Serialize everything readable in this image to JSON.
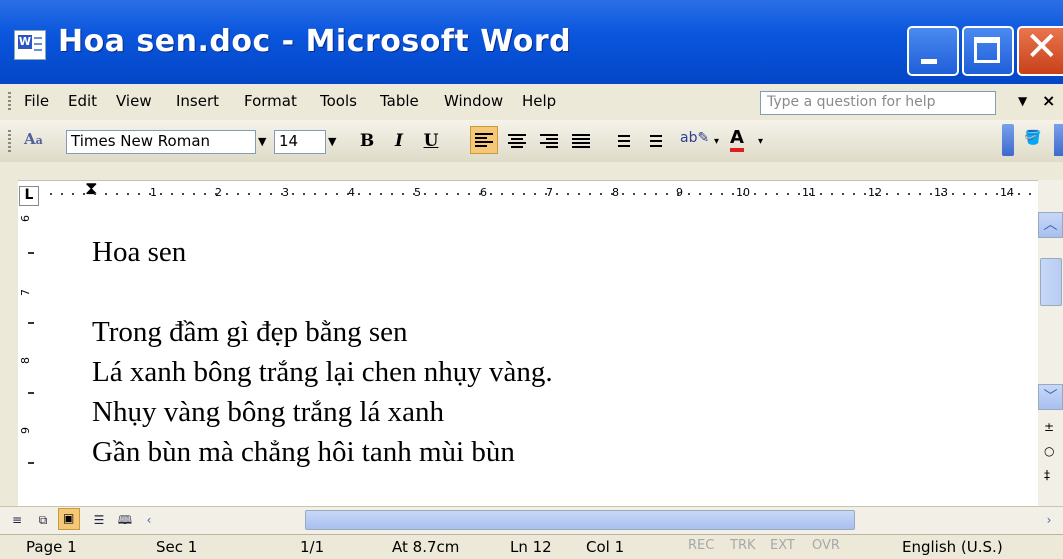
{
  "window": {
    "title": "Hoa sen.doc - Microsoft Word"
  },
  "menu": {
    "items": [
      "File",
      "Edit",
      "View",
      "Insert",
      "Format",
      "Tools",
      "Table",
      "Window",
      "Help"
    ],
    "help_placeholder": "Type a question for help"
  },
  "toolbar": {
    "font": "Times New Roman",
    "size": "14",
    "bold": "B",
    "italic": "I",
    "underline": "U",
    "font_color_letter": "A"
  },
  "ruler": {
    "numbers": [
      "1",
      "2",
      "3",
      "4",
      "5",
      "6",
      "7",
      "8",
      "9",
      "10",
      "11",
      "12",
      "13",
      "14"
    ],
    "vertical_numbers": [
      "6",
      "7",
      "8",
      "9"
    ],
    "tab_selector": "L"
  },
  "document": {
    "lines": [
      "Hoa sen",
      "",
      "Trong đầm gì đẹp bằng sen",
      "Lá xanh bông trắng lại chen nhụy vàng.",
      "Nhụy vàng bông trắng lá xanh",
      "Gần bùn mà chẳng hôi tanh mùi bùn"
    ]
  },
  "status": {
    "page": "Page 1",
    "sec": "Sec 1",
    "page_of": "1/1",
    "at": "At 8.7cm",
    "ln": "Ln 12",
    "col": "Col 1",
    "rec": "REC",
    "trk": "TRK",
    "ext": "EXT",
    "ovr": "OVR",
    "language": "English (U.S.)"
  },
  "colors": {
    "titlebar": "#0a56dd",
    "close": "#c8401a",
    "chrome": "#ECE9D8",
    "highlight": "#f4c878"
  }
}
